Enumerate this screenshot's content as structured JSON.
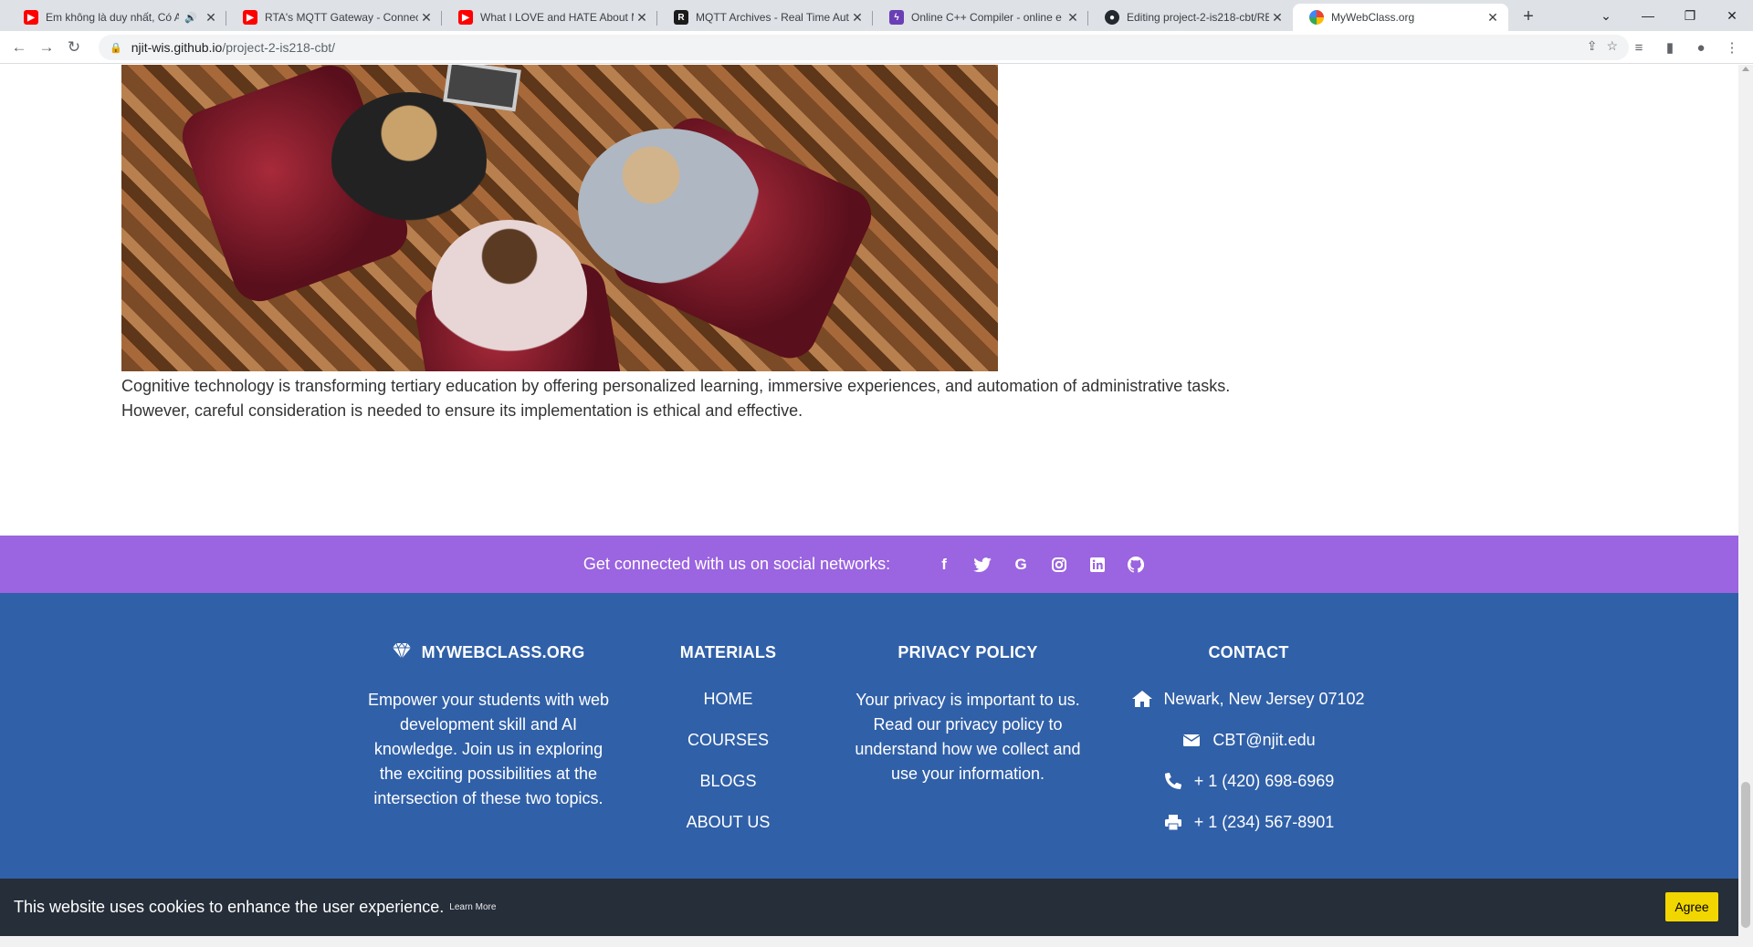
{
  "browser": {
    "tabs": [
      {
        "title": "Em không là duy nhất, Có A",
        "favicon": "youtube-icon",
        "audio": true
      },
      {
        "title": "RTA's MQTT Gateway - Connecti",
        "favicon": "youtube-icon"
      },
      {
        "title": "What I LOVE and HATE About M",
        "favicon": "youtube-icon"
      },
      {
        "title": "MQTT Archives - Real Time Auto",
        "favicon": "rta-icon"
      },
      {
        "title": "Online C++ Compiler - online e",
        "favicon": "bolt-icon"
      },
      {
        "title": "Editing project-2-is218-cbt/REA",
        "favicon": "github-icon"
      },
      {
        "title": "MyWebClass.org",
        "favicon": "mywebclass-icon",
        "active": true
      }
    ],
    "url_host": "njit-wis.github.io",
    "url_path": "/project-2-is218-cbt/"
  },
  "article": {
    "text_line1": "Cognitive technology is transforming tertiary education by offering personalized learning, immersive experiences, and automation of administrative tasks.",
    "text_line2": "However, careful consideration is needed to ensure its implementation is ethical and effective."
  },
  "social": {
    "lead": "Get connected with us on social networks:",
    "icons": [
      "facebook-icon",
      "twitter-icon",
      "google-icon",
      "instagram-icon",
      "linkedin-icon",
      "github-icon"
    ]
  },
  "footer": {
    "brand": {
      "title": "MYWEBCLASS.ORG",
      "text": "Empower your students with web development skill and AI knowledge. Join us in exploring the exciting possibilities at the intersection of these two topics."
    },
    "materials": {
      "title": "MATERIALS",
      "links": [
        "HOME",
        "COURSES",
        "BLOGS",
        "ABOUT US"
      ]
    },
    "privacy": {
      "title": "PRIVACY POLICY",
      "text": "Your privacy is important to us. Read our privacy policy to understand how we collect and use your information."
    },
    "contact": {
      "title": "CONTACT",
      "address": "Newark, New Jersey 07102",
      "email": "CBT@njit.edu",
      "phone": "+ 1 (420) 698-6969",
      "fax": "+ 1 (234) 567-8901"
    }
  },
  "cookie": {
    "message": "This website uses cookies to enhance the user experience.",
    "learn_more": "Learn More",
    "agree": "Agree"
  },
  "colors": {
    "social_bar": "#9b64e0",
    "footer": "#3060a8",
    "cookie_bar": "#252e39",
    "agree_button": "#f1d600"
  }
}
